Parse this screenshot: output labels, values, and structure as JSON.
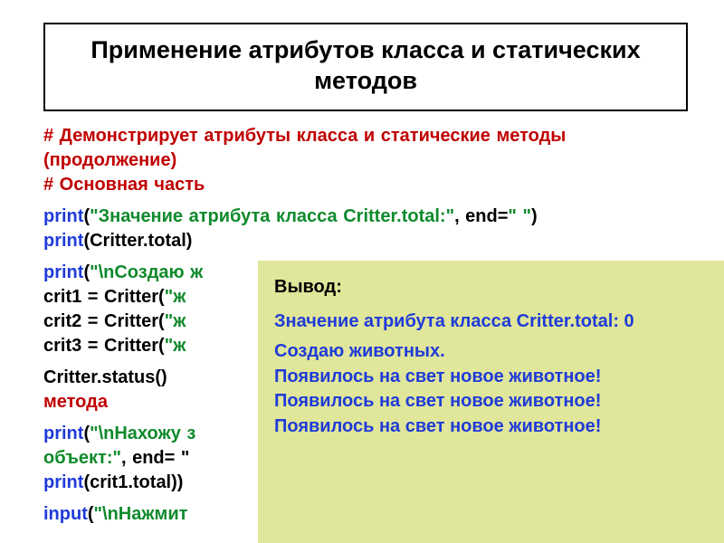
{
  "title": "Применение атрибутов класса и статических  методов",
  "comment1": "# Демонстрирует атрибуты класса и статические методы (продолжение)",
  "comment2": "# Основная часть",
  "l1_kw": "print",
  "l1_p1": "(",
  "l1_str": "\"Значение атрибута класса Critter.total:\"",
  "l1_p2": ", end=",
  "l1_end": "\" \"",
  "l1_p3": ")",
  "l2_kw": "print",
  "l2_rest": "(Critter.total)",
  "l3_kw": "print",
  "l3_p1": "(",
  "l3_str": "\"\\nСоздаю ж",
  "l4a": "crit1 = Critter(",
  "l4b": "\"ж",
  "l5a": "crit2 = Critter(",
  "l5b": "\"ж",
  "l6a": "crit3 = Critter(",
  "l6b": "\"ж",
  "l7": "Critter.status()",
  "l7com": "метода",
  "l8_kw": "print",
  "l8_p1": "(",
  "l8_str": "\"\\nНахожу з",
  "l9_str": "объект:\"",
  "l9_rest": ", end= \"",
  "l10_kw": "print",
  "l10_rest": "(crit1.total))",
  "l11_kw": "input",
  "l11_p1": "(",
  "l11_str": "\"\\nНажмит",
  "output": {
    "title": "Вывод:",
    "line1": "Значение атрибута класса Critter.total:  0",
    "line2": "Создаю животных.",
    "line3": "Появилось на свет новое животное!",
    "line4": "Появилось на свет новое животное!",
    "line5": "Появилось на свет новое животное!"
  }
}
